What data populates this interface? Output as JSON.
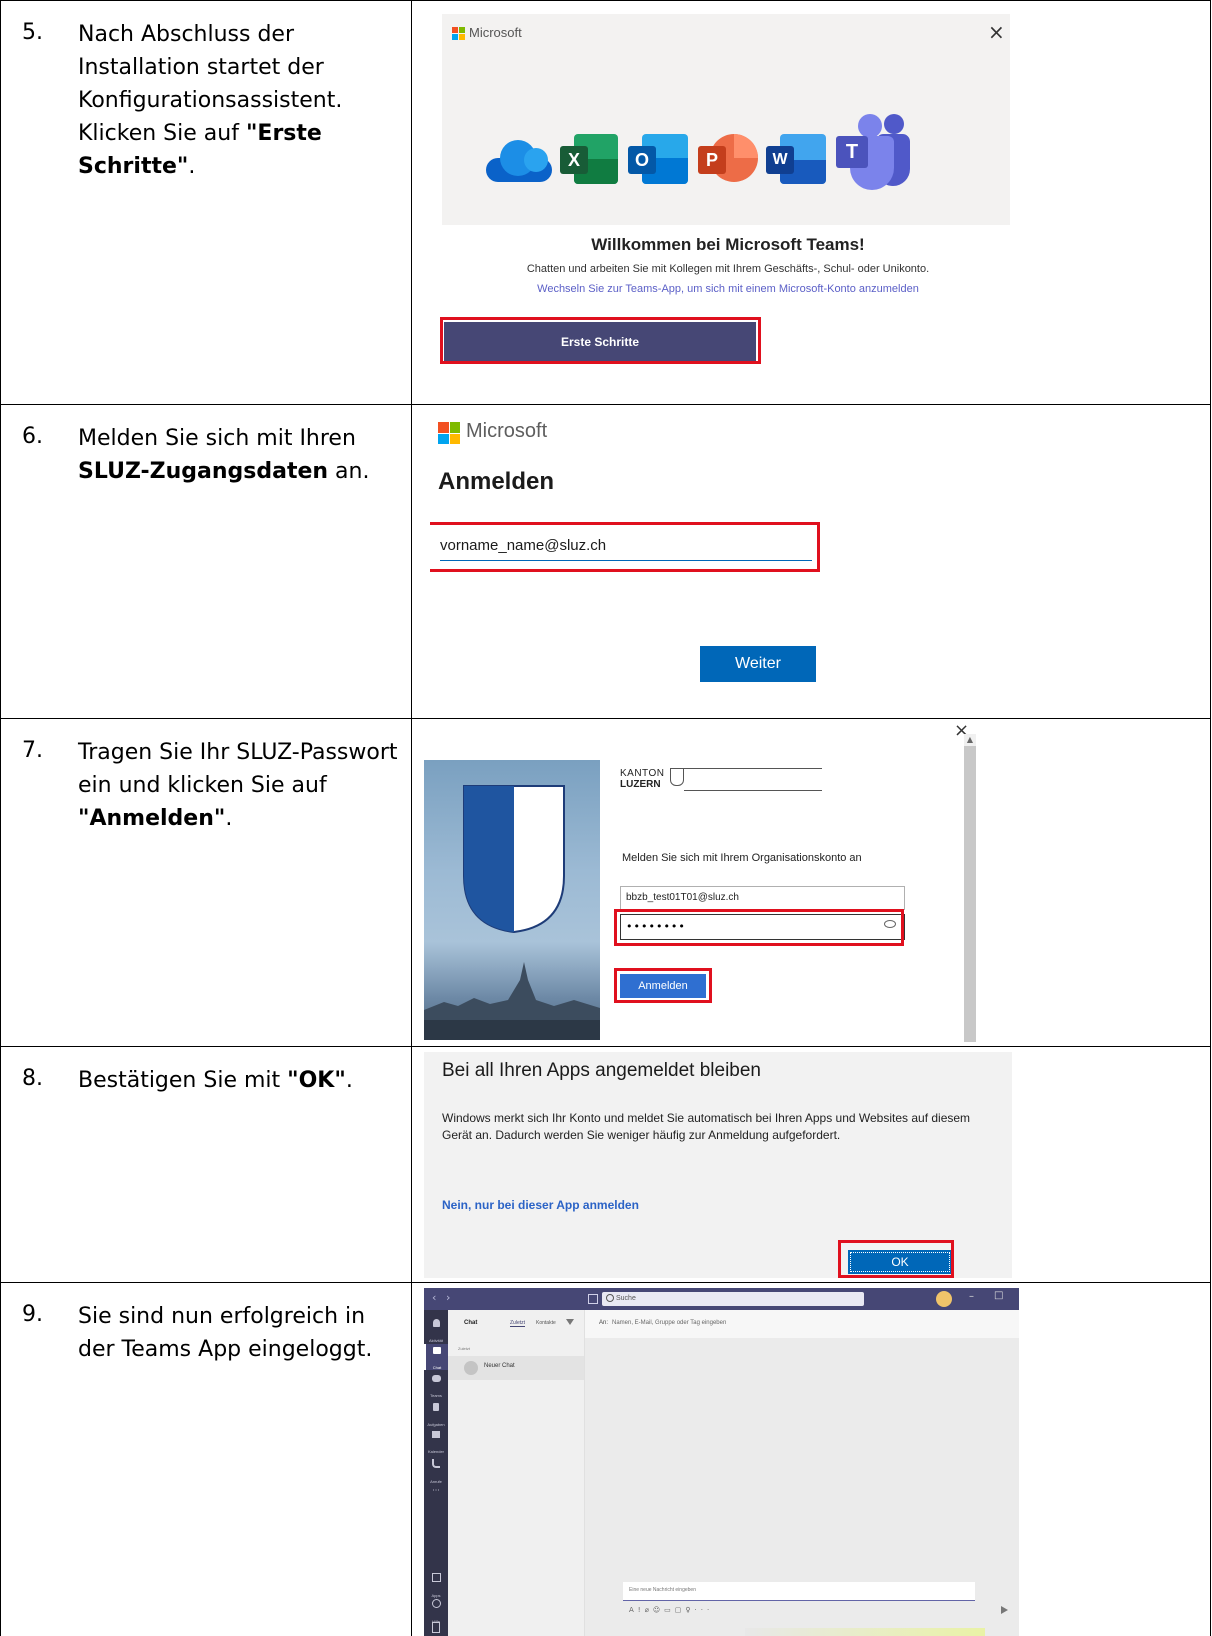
{
  "steps": [
    {
      "number": "5.",
      "text_before": "Nach Abschluss der Installation startet der Konfigurationsassistent. Klicken Sie auf ",
      "text_bold": "\"Erste Schritte\"",
      "text_after": ".",
      "screenshot": {
        "brand": "Microsoft",
        "close": "×",
        "app_icons": [
          "onedrive-icon",
          "excel-icon",
          "outlook-icon",
          "powerpoint-icon",
          "word-icon",
          "teams-icon"
        ],
        "app_letters": {
          "excel": "X",
          "outlook": "O",
          "powerpoint": "P",
          "word": "W",
          "teams": "T"
        },
        "headline": "Willkommen bei Microsoft Teams!",
        "subline": "Chatten und arbeiten Sie mit Kollegen mit Ihrem Geschäfts-, Schul- oder Unikonto.",
        "link": "Wechseln Sie zur Teams-App, um sich mit einem Microsoft-Konto anzumelden",
        "button": "Erste Schritte"
      }
    },
    {
      "number": "6.",
      "text_before": "Melden Sie sich mit Ihren ",
      "text_bold": "SLUZ-Zugangsdaten",
      "text_after": " an.",
      "screenshot": {
        "brand": "Microsoft",
        "title": "Anmelden",
        "email_value": "vorname_name@sluz.ch",
        "button": "Weiter"
      }
    },
    {
      "number": "7.",
      "text_before": "Tragen Sie Ihr SLUZ-Passwort ein und klicken Sie auf ",
      "text_bold": "\"Anmelden\"",
      "text_after": ".",
      "screenshot": {
        "close": "×",
        "canton_line1": "KANTON",
        "canton_line2": "LUZERN",
        "prompt": "Melden Sie sich mit Ihrem Organisationskonto an",
        "username": "bbzb_test01T01@sluz.ch",
        "password": "••••••••",
        "button": "Anmelden"
      }
    },
    {
      "number": "8.",
      "text_before": "Bestätigen Sie mit ",
      "text_bold": "\"OK\"",
      "text_after": ".",
      "screenshot": {
        "title": "Bei all Ihren Apps angemeldet bleiben",
        "body": "Windows merkt sich Ihr Konto und meldet Sie automatisch bei Ihren Apps und Websites auf diesem Gerät an. Dadurch werden Sie weniger häufig zur Anmeldung aufgefordert.",
        "link": "Nein, nur bei dieser App anmelden",
        "button": "OK"
      }
    },
    {
      "number": "9.",
      "text_before": "Sie sind nun erfolgreich in der Teams App eingeloggt.",
      "text_bold": "",
      "text_after": "",
      "screenshot": {
        "search_placeholder": "Suche",
        "nav": [
          "Aktivität",
          "Chat",
          "Teams",
          "Aufgaben",
          "Kalender",
          "Anrufe",
          "Apps",
          "Hilfe"
        ],
        "nav_more": "···",
        "chat_header": "Chat",
        "tab_recent": "Zuletzt",
        "tab_contacts": "Kontakte",
        "section_recent": "Zuletzt",
        "new_chat": "Neuer Chat",
        "to_label": "An:",
        "to_placeholder": "Namen, E-Mail, Gruppe oder Tag eingeben",
        "compose_placeholder": "Eine neue Nachricht eingeben",
        "window_min": "–",
        "window_max": "□"
      }
    }
  ],
  "colors": {
    "teams_purple": "#464775",
    "ms_blue": "#0067b8",
    "highlight_red": "#e0101e",
    "link_blue": "#2b63c6"
  }
}
